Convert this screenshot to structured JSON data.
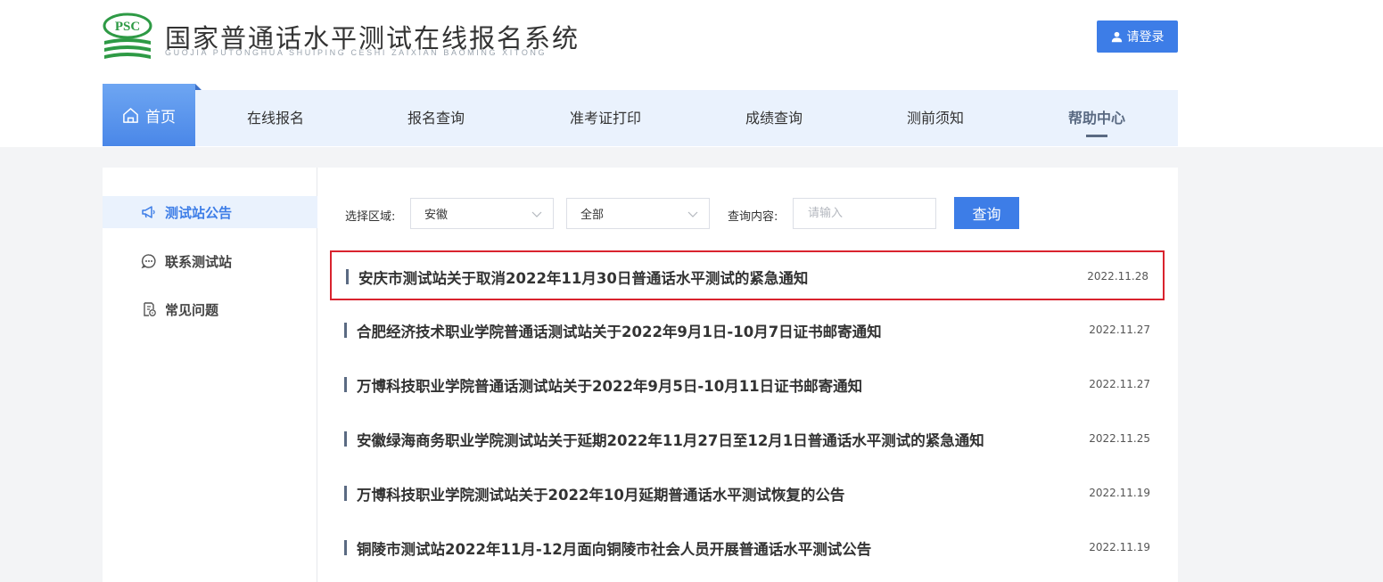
{
  "header": {
    "logo_text": "PSC",
    "title": "国家普通话水平测试在线报名系统",
    "subtitle": "GUOJIA PUTONGHUA SHUIPING CESHI ZAIXIAN BAOMING XITONG",
    "login_label": "请登录"
  },
  "nav": {
    "home": "首页",
    "items": [
      {
        "label": "在线报名"
      },
      {
        "label": "报名查询"
      },
      {
        "label": "准考证打印"
      },
      {
        "label": "成绩查询"
      },
      {
        "label": "测前须知"
      },
      {
        "label": "帮助中心"
      }
    ]
  },
  "sidebar": {
    "items": [
      {
        "label": "测试站公告",
        "icon": "megaphone-icon"
      },
      {
        "label": "联系测试站",
        "icon": "chat-icon"
      },
      {
        "label": "常见问题",
        "icon": "document-question-icon"
      }
    ]
  },
  "filter": {
    "region_label": "选择区域:",
    "region_value": "安徽",
    "scope_value": "全部",
    "query_label": "查询内容:",
    "query_placeholder": "请输入",
    "query_button": "查询"
  },
  "news": [
    {
      "title": "安庆市测试站关于取消2022年11月30日普通话水平测试的紧急通知",
      "date": "2022.11.28"
    },
    {
      "title": "合肥经济技术职业学院普通话测试站关于2022年9月1日-10月7日证书邮寄通知",
      "date": "2022.11.27"
    },
    {
      "title": "万博科技职业学院普通话测试站关于2022年9月5日-10月11日证书邮寄通知",
      "date": "2022.11.27"
    },
    {
      "title": "安徽绿海商务职业学院测试站关于延期2022年11月27日至12月1日普通话水平测试的紧急通知",
      "date": "2022.11.25"
    },
    {
      "title": "万博科技职业学院测试站关于2022年10月延期普通话水平测试恢复的公告",
      "date": "2022.11.19"
    },
    {
      "title": "铜陵市测试站2022年11月-12月面向铜陵市社会人员开展普通话水平测试公告",
      "date": "2022.11.19"
    }
  ],
  "colors": {
    "accent": "#3d7de7",
    "highlight_border": "#d9232e",
    "logo_green": "#2e9a45"
  }
}
